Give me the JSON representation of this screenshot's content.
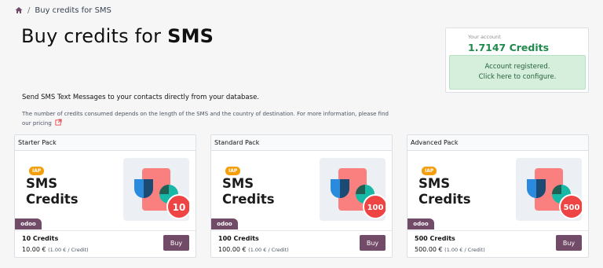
{
  "breadcrumb": {
    "current": "Buy credits for SMS"
  },
  "title": {
    "prefix": "Buy credits for ",
    "bold": "SMS"
  },
  "account": {
    "label": "Your account",
    "credits": "1.7147 Credits",
    "alert_line1": "Account registered.",
    "alert_line2": "Click here to configure."
  },
  "intro": "Send SMS Text Messages to your contacts directly from your database.",
  "note": "The number of credits consumed depends on the length of the SMS and the country of destination. For more information, please find our pricing",
  "packs": [
    {
      "header": "Starter Pack",
      "badge": "IAP",
      "line1": "SMS",
      "line2": "Credits",
      "circle": "10",
      "brand": "odoo",
      "credits": "10 Credits",
      "price": "10.00 €",
      "unit": "(1.00 € / Credit)",
      "buy": "Buy"
    },
    {
      "header": "Standard Pack",
      "badge": "IAP",
      "line1": "SMS",
      "line2": "Credits",
      "circle": "100",
      "brand": "odoo",
      "credits": "100 Credits",
      "price": "100.00 €",
      "unit": "(1.00 € / Credit)",
      "buy": "Buy"
    },
    {
      "header": "Advanced Pack",
      "badge": "IAP",
      "line1": "SMS",
      "line2": "Credits",
      "circle": "500",
      "brand": "odoo",
      "credits": "500 Credits",
      "price": "500.00 €",
      "unit": "(1.00 € / Credit)",
      "buy": "Buy"
    }
  ],
  "colors": {
    "brand": "#714b67",
    "credits_green": "#1f8a4c",
    "alert_bg": "#d6efdc",
    "badge_orange": "#f59e0b",
    "circle_red": "#ef4444"
  },
  "icons": {
    "home": "home-icon",
    "external": "external-link-icon"
  }
}
